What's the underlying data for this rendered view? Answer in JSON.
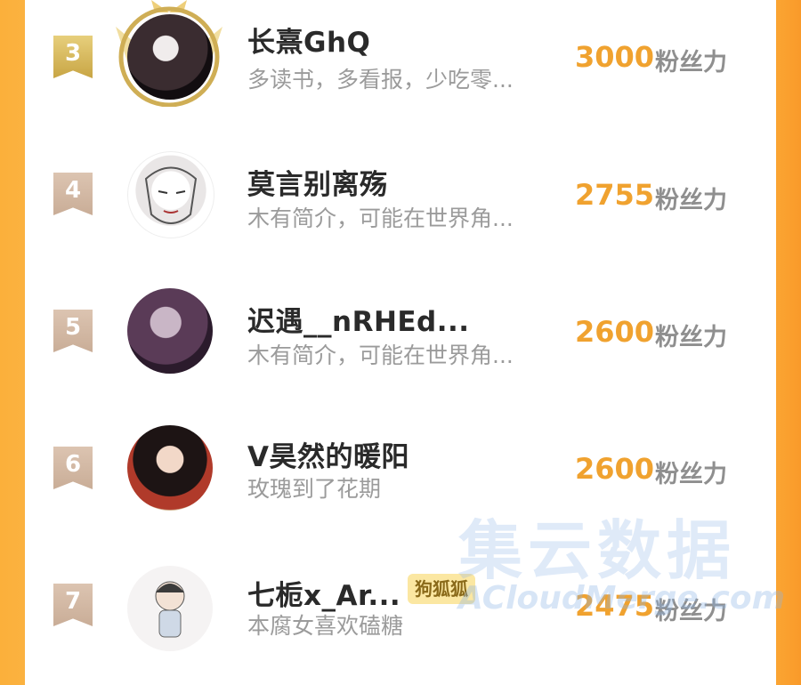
{
  "ranking": [
    {
      "rank": "3",
      "name": "长熹GhQ",
      "bio": "多读书，多看报，少吃零...",
      "score": "3000",
      "unit": "粉丝力"
    },
    {
      "rank": "4",
      "name": "莫言别离殇",
      "bio": "木有简介，可能在世界角...",
      "score": "2755",
      "unit": "粉丝力"
    },
    {
      "rank": "5",
      "name": "迟遇__nRHEd...",
      "bio": "木有简介，可能在世界角...",
      "score": "2600",
      "unit": "粉丝力"
    },
    {
      "rank": "6",
      "name": "V昊然的暖阳",
      "bio": "玫瑰到了花期",
      "score": "2600",
      "unit": "粉丝力"
    },
    {
      "rank": "7",
      "name": "七栀x_Ar...",
      "bio": "本腐女喜欢磕糖",
      "score": "2475",
      "unit": "粉丝力",
      "badge": "狗狐狐"
    }
  ],
  "watermark": {
    "title": "集云数据",
    "subtitle": "ACloudMerge.com"
  },
  "colors": {
    "accent": "#f0a22f",
    "side": "#fbb03b",
    "gold_rank": "#d4b55a",
    "plain_rank": "#d3b9a4"
  }
}
